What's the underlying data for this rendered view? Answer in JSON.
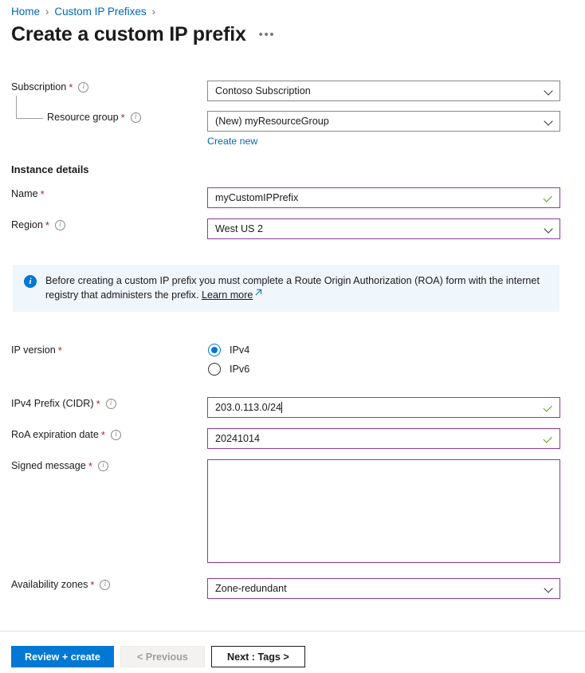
{
  "breadcrumb": {
    "items": [
      {
        "label": "Home"
      },
      {
        "label": "Custom IP Prefixes"
      }
    ],
    "separator": "›"
  },
  "header": {
    "title": "Create a custom IP prefix",
    "more_label": "•••"
  },
  "form": {
    "subscription": {
      "label": "Subscription",
      "required": "*",
      "info": "i",
      "value": "Contoso Subscription"
    },
    "resource_group": {
      "label": "Resource group",
      "required": "*",
      "info": "i",
      "value": "(New) myResourceGroup",
      "create_new_label": "Create new"
    },
    "instance_details_heading": "Instance details",
    "name": {
      "label": "Name",
      "required": "*",
      "value": "myCustomIPPrefix"
    },
    "region": {
      "label": "Region",
      "required": "*",
      "info": "i",
      "value": "West US 2"
    },
    "ip_version": {
      "label": "IP version",
      "required": "*",
      "options": [
        {
          "label": "IPv4",
          "selected": true
        },
        {
          "label": "IPv6",
          "selected": false
        }
      ]
    },
    "ipv4_prefix": {
      "label": "IPv4 Prefix (CIDR)",
      "required": "*",
      "info": "i",
      "value": "203.0.113.0/24"
    },
    "roa_expiration": {
      "label": "RoA expiration date",
      "required": "*",
      "info": "i",
      "value": "20241014"
    },
    "signed_message": {
      "label": "Signed message",
      "required": "*",
      "info": "i",
      "value": ""
    },
    "availability_zones": {
      "label": "Availability zones",
      "required": "*",
      "info": "i",
      "value": "Zone-redundant"
    }
  },
  "banner": {
    "icon": "info-icon",
    "text": "Before creating a custom IP prefix you must complete a Route Origin Authorization (ROA) form with the internet registry that administers the prefix.",
    "link_label": "Learn more"
  },
  "footer": {
    "review_create_label": "Review + create",
    "previous_label": "< Previous",
    "next_label": "Next : Tags >"
  },
  "colors": {
    "accent": "#0078d4",
    "link": "#0067b8",
    "required_star": "#a4262c",
    "input_focus_border": "#8e3a9e",
    "input_border": "#8a8886",
    "valid_check": "#5aa32a",
    "banner_bg": "#eff6fc"
  }
}
